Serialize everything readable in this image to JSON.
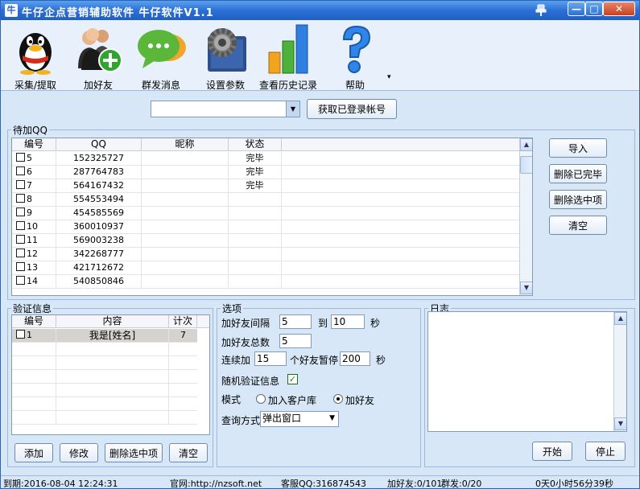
{
  "window": {
    "app_icon": "牛",
    "title": "牛仔企点营销辅助软件 牛仔软件V1.1",
    "min": "—",
    "max": "□",
    "close": "✕"
  },
  "toolbar": {
    "items": [
      {
        "label": "采集/提取",
        "icon": "qq-penguin-icon"
      },
      {
        "label": "加好友",
        "icon": "add-friend-icon"
      },
      {
        "label": "群发消息",
        "icon": "chat-bubble-icon"
      },
      {
        "label": "设置参数",
        "icon": "settings-gear-icon"
      },
      {
        "label": "查看历史记录",
        "icon": "bar-chart-icon"
      },
      {
        "label": "帮助",
        "icon": "help-question-icon"
      }
    ],
    "more": "▾"
  },
  "account": {
    "selected": "",
    "fetch_button": "获取已登录帐号"
  },
  "pending": {
    "legend": "待加QQ",
    "columns": [
      "编号",
      "QQ",
      "昵称",
      "状态"
    ],
    "rows": [
      {
        "id": "5",
        "qq": "152325727",
        "nick": "",
        "status": "完毕"
      },
      {
        "id": "6",
        "qq": "287764783",
        "nick": "",
        "status": "完毕"
      },
      {
        "id": "7",
        "qq": "564167432",
        "nick": "",
        "status": "完毕"
      },
      {
        "id": "8",
        "qq": "554553494",
        "nick": "",
        "status": ""
      },
      {
        "id": "9",
        "qq": "454585569",
        "nick": "",
        "status": ""
      },
      {
        "id": "10",
        "qq": "360010937",
        "nick": "",
        "status": ""
      },
      {
        "id": "11",
        "qq": "569003238",
        "nick": "",
        "status": ""
      },
      {
        "id": "12",
        "qq": "342268777",
        "nick": "",
        "status": ""
      },
      {
        "id": "13",
        "qq": "421712672",
        "nick": "",
        "status": ""
      },
      {
        "id": "14",
        "qq": "540850846",
        "nick": "",
        "status": ""
      }
    ],
    "buttons": [
      "导入",
      "删除已完毕",
      "删除选中项",
      "清空"
    ]
  },
  "verify": {
    "legend": "验证信息",
    "columns": [
      "编号",
      "内容",
      "计次"
    ],
    "rows": [
      {
        "id": "1",
        "content": "我是[姓名]",
        "count": "7"
      }
    ],
    "buttons": [
      "添加",
      "修改",
      "删除选中项",
      "清空"
    ]
  },
  "options": {
    "legend": "选项",
    "interval_label": "加好友间隔",
    "interval_from": "5",
    "to_label": "到",
    "interval_to": "10",
    "sec_label": "秒",
    "total_label": "加好友总数",
    "total": "5",
    "continuous_label": "连续加",
    "continuous": "15",
    "pause_label": "个好友暂停",
    "pause": "200",
    "pause_sec": "秒",
    "random_label": "随机验证信息",
    "random_checked": "✓",
    "mode_label": "模式",
    "mode_opt1": "加入客户库",
    "mode_opt2": "加好友",
    "query_label": "查询方式",
    "query_value": "弹出窗口"
  },
  "log": {
    "legend": "日志",
    "start_button": "开始",
    "stop_button": "停止"
  },
  "status": {
    "expire": "到期:2016-08-04 12:24:31",
    "site": "官网:http://nzsoft.net",
    "service": "客服QQ:316874543",
    "add": "加好友:0/101",
    "group": "群发:0/20",
    "runtime": "0天0小时56分39秒"
  }
}
